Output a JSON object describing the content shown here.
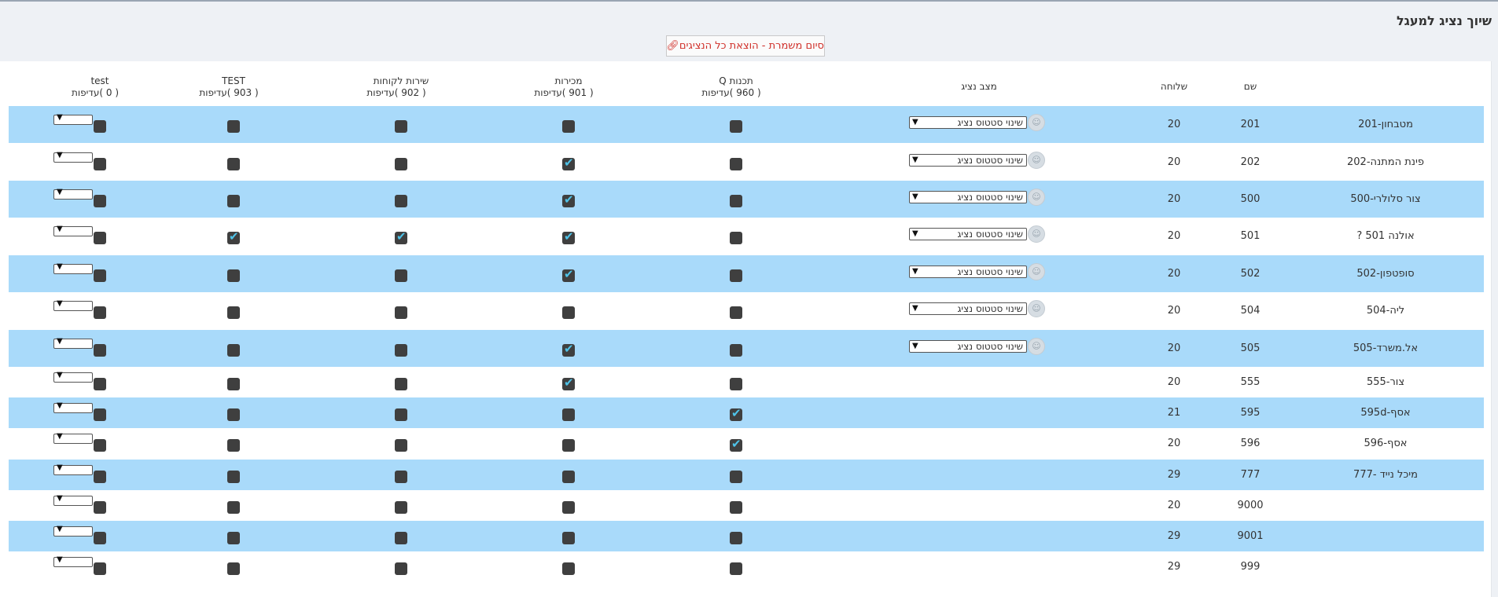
{
  "page_title": "שיוך נציג למעגל",
  "end_shift_button": {
    "icon": "paperclip-icon",
    "label": "סיום משמרת - הוצאת כל הנציגים"
  },
  "columns": {
    "name": "שם",
    "extension": "שלוחה",
    "agent_status": "מצב נציג",
    "queues": [
      {
        "title": "תכנות Q",
        "count": "( 960 )",
        "priority_label": "עדיפות"
      },
      {
        "title": "מכירות",
        "count": "( 901 )",
        "priority_label": "עדיפות"
      },
      {
        "title": "שירות לקוחות",
        "count": "( 902 )",
        "priority_label": "עדיפות"
      },
      {
        "title": "TEST",
        "count": "( 903 )",
        "priority_label": "עדיפות"
      },
      {
        "title": "test",
        "count": "( 0 )",
        "priority_label": "עדיפות"
      }
    ]
  },
  "status_select_label": "שינוי סטטוס נציג",
  "colors": {
    "alt_row": "#a9dafa",
    "checkbox": "#3f3f3f",
    "check_mark": "#4fc3e8",
    "button_text": "#d0302a"
  },
  "rows": [
    {
      "label": "מטבחון-201",
      "name": "201",
      "ext": "20",
      "status": true,
      "checks": [
        false,
        false,
        false,
        false,
        false
      ]
    },
    {
      "label": "פינת המתנה-202",
      "name": "202",
      "ext": "20",
      "status": true,
      "checks": [
        false,
        true,
        false,
        false,
        false
      ]
    },
    {
      "label": "צור סלולרי-500",
      "name": "500",
      "ext": "20",
      "status": true,
      "checks": [
        false,
        true,
        false,
        false,
        false
      ]
    },
    {
      "label": "אולנה 501 ?",
      "name": "501",
      "ext": "20",
      "status": true,
      "checks": [
        false,
        true,
        true,
        true,
        false
      ]
    },
    {
      "label": "סופטפון-502",
      "name": "502",
      "ext": "20",
      "status": true,
      "checks": [
        false,
        true,
        false,
        false,
        false
      ]
    },
    {
      "label": "ליה-504",
      "name": "504",
      "ext": "20",
      "status": true,
      "checks": [
        false,
        false,
        false,
        false,
        false
      ]
    },
    {
      "label": "אל.משרד-505",
      "name": "505",
      "ext": "20",
      "status": true,
      "checks": [
        false,
        true,
        false,
        false,
        false
      ]
    },
    {
      "label": "צור-555",
      "name": "555",
      "ext": "20",
      "status": false,
      "checks": [
        false,
        true,
        false,
        false,
        false
      ]
    },
    {
      "label": "אסף-595d",
      "name": "595",
      "ext": "21",
      "status": false,
      "checks": [
        true,
        false,
        false,
        false,
        false
      ]
    },
    {
      "label": "אסף-596",
      "name": "596",
      "ext": "20",
      "status": false,
      "checks": [
        true,
        false,
        false,
        false,
        false
      ]
    },
    {
      "label": "מיכל נייד -777",
      "name": "777",
      "ext": "29",
      "status": false,
      "checks": [
        false,
        false,
        false,
        false,
        false
      ]
    },
    {
      "label": "",
      "name": "9000",
      "ext": "20",
      "status": false,
      "checks": [
        false,
        false,
        false,
        false,
        false
      ]
    },
    {
      "label": "",
      "name": "9001",
      "ext": "29",
      "status": false,
      "checks": [
        false,
        false,
        false,
        false,
        false
      ]
    },
    {
      "label": "",
      "name": "999",
      "ext": "29",
      "status": false,
      "checks": [
        false,
        false,
        false,
        false,
        false
      ]
    }
  ]
}
